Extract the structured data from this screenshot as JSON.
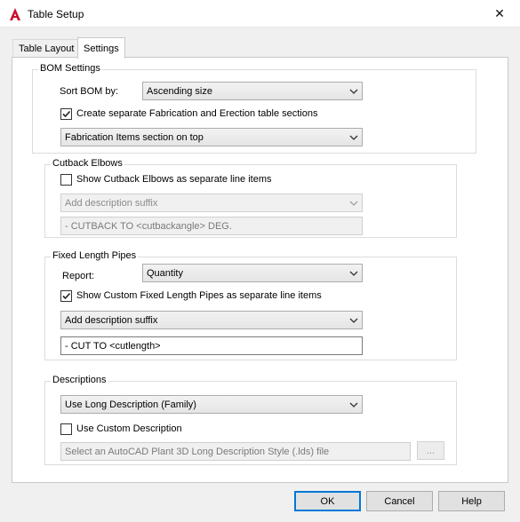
{
  "window": {
    "title": "Table Setup",
    "close_glyph": "✕",
    "app_icon": "autocad-plant-3d-icon",
    "accent": "#c8102e"
  },
  "tabs": [
    {
      "label": "Table Layout",
      "active": false
    },
    {
      "label": "Settings",
      "active": true
    }
  ],
  "bom": {
    "legend": "BOM Settings",
    "sort_label": "Sort BOM by:",
    "sort_value": "Ascending size",
    "separate_sections": {
      "label": "Create separate Fabrication and Erection table sections",
      "checked": true
    },
    "section_value": "Fabrication Items section on top"
  },
  "cutback": {
    "legend": "Cutback Elbows",
    "show_separate": {
      "label": "Show Cutback Elbows as separate line items",
      "checked": false
    },
    "suffix_value": "Add description suffix",
    "suffix_text": "- CUTBACK TO <cutbackangle> DEG."
  },
  "fixed": {
    "legend": "Fixed Length Pipes",
    "report_label": "Report:",
    "report_value": "Quantity",
    "show_custom": {
      "label": "Show Custom Fixed Length Pipes as separate line items",
      "checked": true
    },
    "suffix_value": "Add description suffix",
    "suffix_text": "- CUT TO <cutlength>"
  },
  "descriptions": {
    "legend": "Descriptions",
    "desc_value": "Use Long Description (Family)",
    "use_custom": {
      "label": "Use Custom Description",
      "checked": false
    },
    "style_placeholder": "Select an AutoCAD Plant 3D Long Description Style (.lds) file",
    "browse_label": "..."
  },
  "buttons": {
    "ok": "OK",
    "cancel": "Cancel",
    "help": "Help"
  }
}
